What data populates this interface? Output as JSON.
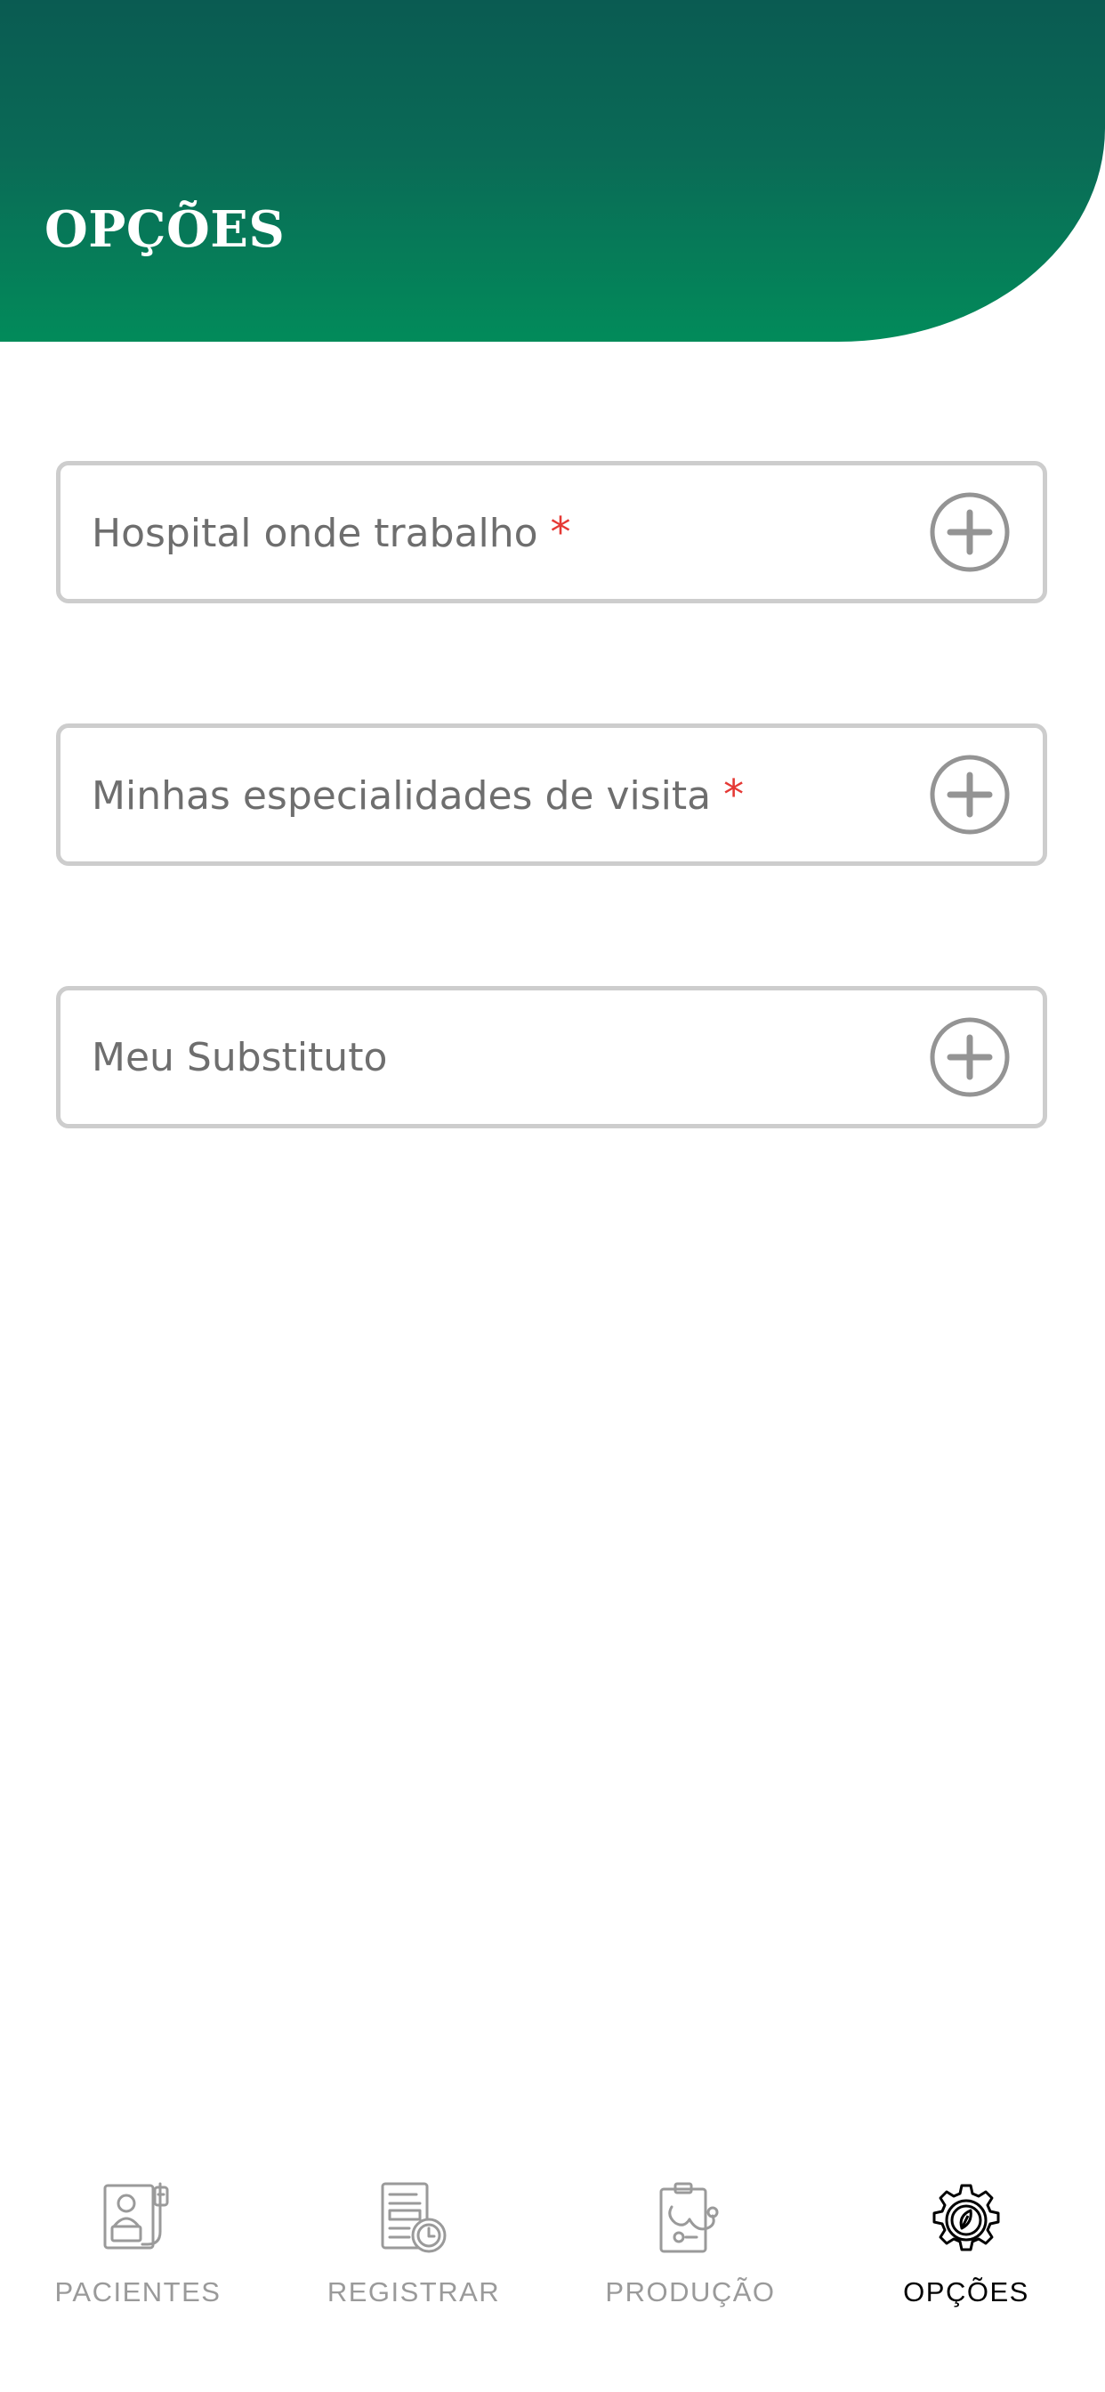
{
  "header": {
    "title": "OPÇÕES"
  },
  "fields": [
    {
      "label": "Hospital onde trabalho",
      "required_mark": "*"
    },
    {
      "label": "Minhas especialidades de visita",
      "required_mark": "*"
    },
    {
      "label": "Meu Substituto"
    }
  ],
  "tabbar": {
    "tabs": [
      {
        "label": "PACIENTES",
        "icon": "patient-icon",
        "active": false
      },
      {
        "label": "REGISTRAR",
        "icon": "register-clock-icon",
        "active": false
      },
      {
        "label": "PRODUÇÃO",
        "icon": "clipboard-stethoscope-icon",
        "active": false
      },
      {
        "label": "OPÇÕES",
        "icon": "gear-icon",
        "active": true
      }
    ]
  },
  "colors": {
    "header_top": "#0a5b52",
    "header_bottom": "#028b5a",
    "required": "#e53935",
    "inactive_tab": "#9a9a9a",
    "active_tab": "#000000"
  }
}
